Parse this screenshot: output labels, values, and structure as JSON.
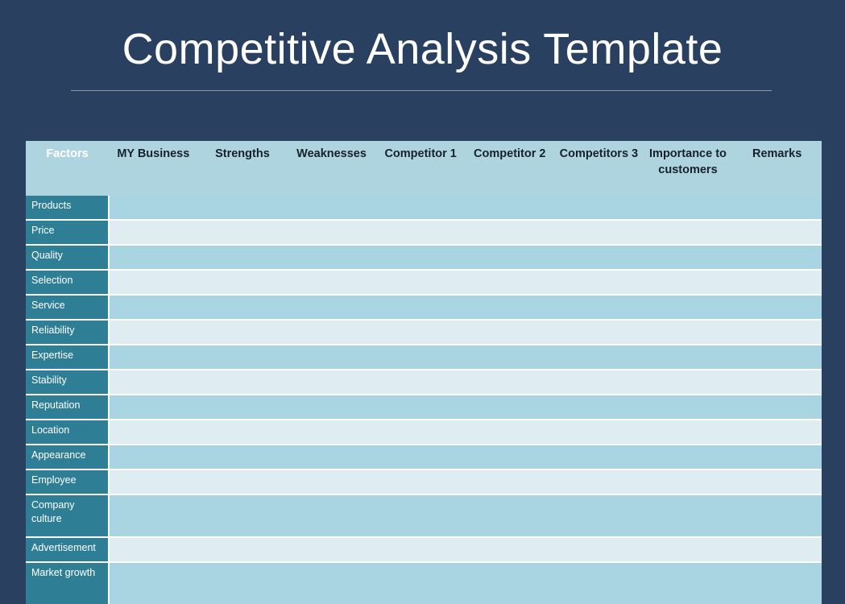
{
  "page": {
    "title": "Competitive Analysis Template",
    "background_color": "#2a4060",
    "title_color": "#ffffff",
    "rule_color": "#8e99a8"
  },
  "table": {
    "header_background": "#aed4e0",
    "factor_column_background": "#2e7f95",
    "band_a_color": "#a9d4e2",
    "band_b_color": "#dfedf3",
    "columns": [
      {
        "label": "Factors",
        "key": "factors"
      },
      {
        "label": "MY Business",
        "key": "my_business"
      },
      {
        "label": "Strengths",
        "key": "strengths"
      },
      {
        "label": "Weaknesses",
        "key": "weaknesses"
      },
      {
        "label": "Competitor 1",
        "key": "competitor_1"
      },
      {
        "label": "Competitor 2",
        "key": "competitor_2"
      },
      {
        "label": "Competitors 3",
        "key": "competitors_3"
      },
      {
        "label": "Importance to customers",
        "key": "importance_to_customers"
      },
      {
        "label": "Remarks",
        "key": "remarks"
      }
    ],
    "rows": [
      {
        "label": "Products",
        "tall": false,
        "values": [
          "",
          "",
          "",
          "",
          "",
          "",
          "",
          ""
        ]
      },
      {
        "label": "Price",
        "tall": false,
        "values": [
          "",
          "",
          "",
          "",
          "",
          "",
          "",
          ""
        ]
      },
      {
        "label": "Quality",
        "tall": false,
        "values": [
          "",
          "",
          "",
          "",
          "",
          "",
          "",
          ""
        ]
      },
      {
        "label": "Selection",
        "tall": false,
        "values": [
          "",
          "",
          "",
          "",
          "",
          "",
          "",
          ""
        ]
      },
      {
        "label": "Service",
        "tall": false,
        "values": [
          "",
          "",
          "",
          "",
          "",
          "",
          "",
          ""
        ]
      },
      {
        "label": "Reliability",
        "tall": false,
        "values": [
          "",
          "",
          "",
          "",
          "",
          "",
          "",
          ""
        ]
      },
      {
        "label": "Expertise",
        "tall": false,
        "values": [
          "",
          "",
          "",
          "",
          "",
          "",
          "",
          ""
        ]
      },
      {
        "label": "Stability",
        "tall": false,
        "values": [
          "",
          "",
          "",
          "",
          "",
          "",
          "",
          ""
        ]
      },
      {
        "label": "Reputation",
        "tall": false,
        "values": [
          "",
          "",
          "",
          "",
          "",
          "",
          "",
          ""
        ]
      },
      {
        "label": "Location",
        "tall": false,
        "values": [
          "",
          "",
          "",
          "",
          "",
          "",
          "",
          ""
        ]
      },
      {
        "label": "Appearance",
        "tall": false,
        "values": [
          "",
          "",
          "",
          "",
          "",
          "",
          "",
          ""
        ]
      },
      {
        "label": "Employee",
        "tall": false,
        "values": [
          "",
          "",
          "",
          "",
          "",
          "",
          "",
          ""
        ]
      },
      {
        "label": "Company culture",
        "tall": true,
        "values": [
          "",
          "",
          "",
          "",
          "",
          "",
          "",
          ""
        ]
      },
      {
        "label": "Advertisement",
        "tall": false,
        "values": [
          "",
          "",
          "",
          "",
          "",
          "",
          "",
          ""
        ]
      },
      {
        "label": "Market growth",
        "tall": true,
        "values": [
          "",
          "",
          "",
          "",
          "",
          "",
          "",
          ""
        ]
      }
    ]
  }
}
